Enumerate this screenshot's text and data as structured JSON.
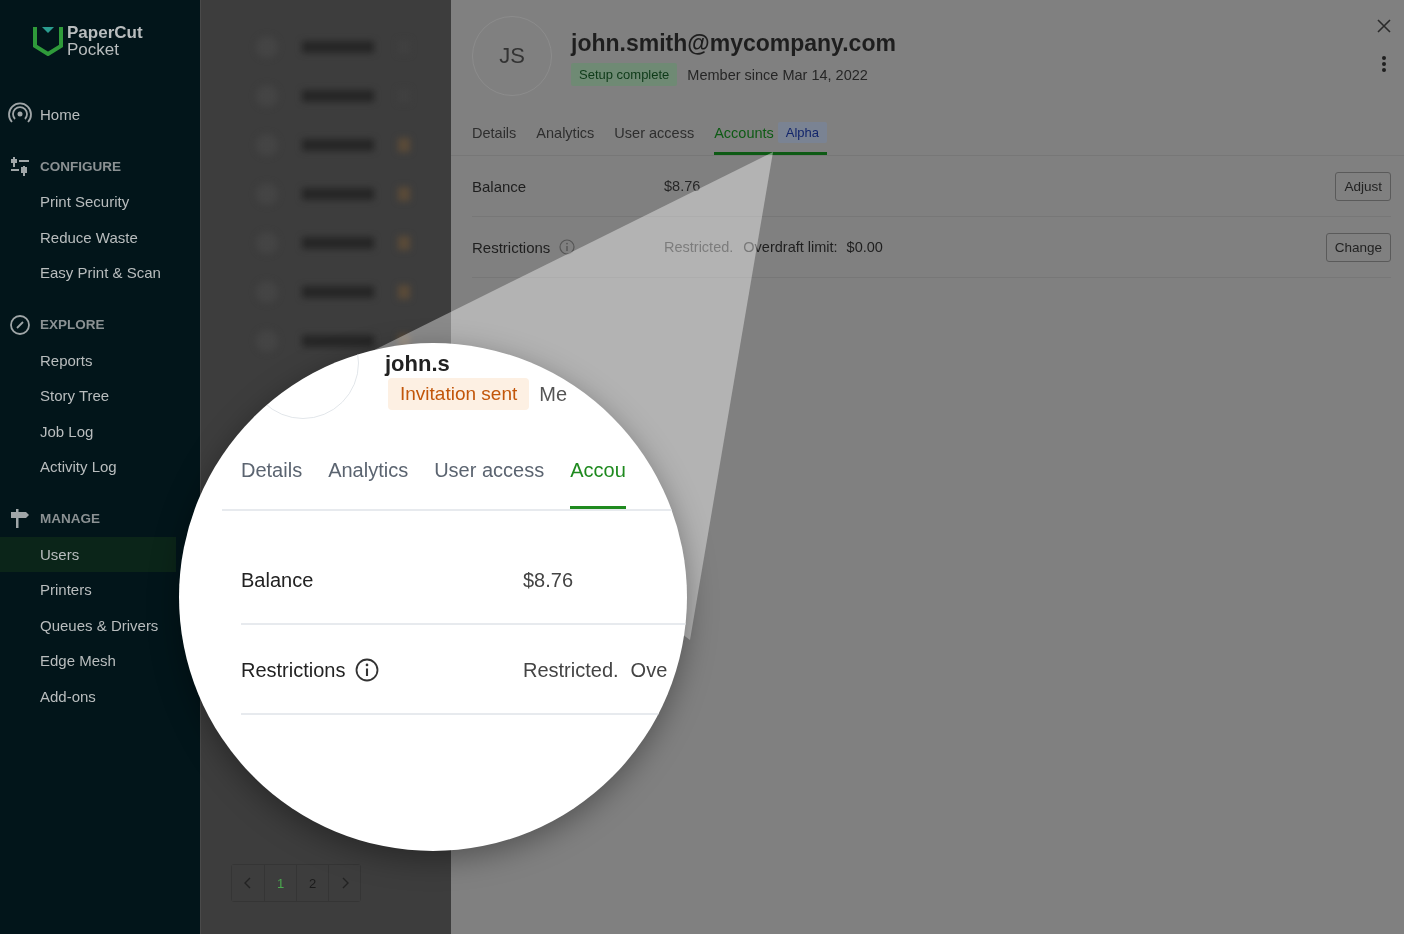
{
  "sidebar": {
    "logo": {
      "line_1": "PaperCut",
      "line_2": "Pocket"
    },
    "home": {
      "label": "Home",
      "selected": false
    },
    "sections": [
      {
        "kind": "configure",
        "heading": "CONFIGURE",
        "items": [
          {
            "label": "Print Security",
            "selected": false
          },
          {
            "label": "Reduce Waste",
            "selected": false
          },
          {
            "label": "Easy Print & Scan",
            "selected": false
          }
        ]
      },
      {
        "kind": "explore",
        "heading": "EXPLORE",
        "items": [
          {
            "label": "Reports",
            "selected": false
          },
          {
            "label": "Story Tree",
            "selected": false
          },
          {
            "label": "Job Log",
            "selected": false
          },
          {
            "label": "Activity Log",
            "selected": false
          }
        ]
      },
      {
        "kind": "manage",
        "heading": "MANAGE",
        "items": [
          {
            "label": "Users",
            "selected": true
          },
          {
            "label": "Printers",
            "selected": false
          },
          {
            "label": "Queues & Drivers",
            "selected": false
          },
          {
            "label": "Edge Mesh",
            "selected": false
          },
          {
            "label": "Add-ons",
            "selected": false
          }
        ]
      }
    ]
  },
  "pagination": {
    "pages": [
      {
        "label": "1",
        "selected": true
      },
      {
        "label": "2",
        "selected": false
      }
    ]
  },
  "user_panel": {
    "initials": "JS",
    "email": "john.smith@mycompany.com",
    "status_badge": "Setup complete",
    "member_since": "Member since Mar 14, 2022",
    "tabs": [
      {
        "label": "Details",
        "selected": false
      },
      {
        "label": "Analytics",
        "selected": false
      },
      {
        "label": "User access",
        "selected": false
      },
      {
        "label": "Accounts",
        "selected": true,
        "badge": "Alpha"
      }
    ],
    "rows": [
      {
        "label": "Balance",
        "info": false,
        "value": "$8.76",
        "button": "Adjust"
      },
      {
        "label": "Restrictions",
        "info": true,
        "value": "Restricted.",
        "detail_label": "Overdraft limit:",
        "detail_value": "$0.00",
        "button": "Change"
      }
    ]
  },
  "magnifier": {
    "heading": "john.s",
    "status_badge": "Invitation sent",
    "member_since": "Me",
    "tabs": [
      {
        "label": "Details",
        "selected": false
      },
      {
        "label": "Analytics",
        "selected": false
      },
      {
        "label": "User access",
        "selected": false
      },
      {
        "label": "Accou",
        "selected": true
      }
    ],
    "rows": [
      {
        "label": "Balance",
        "info": false,
        "value": "$8.76"
      },
      {
        "label": "Restrictions",
        "info": true,
        "value": "Restricted.",
        "detail": "Ove"
      }
    ]
  }
}
